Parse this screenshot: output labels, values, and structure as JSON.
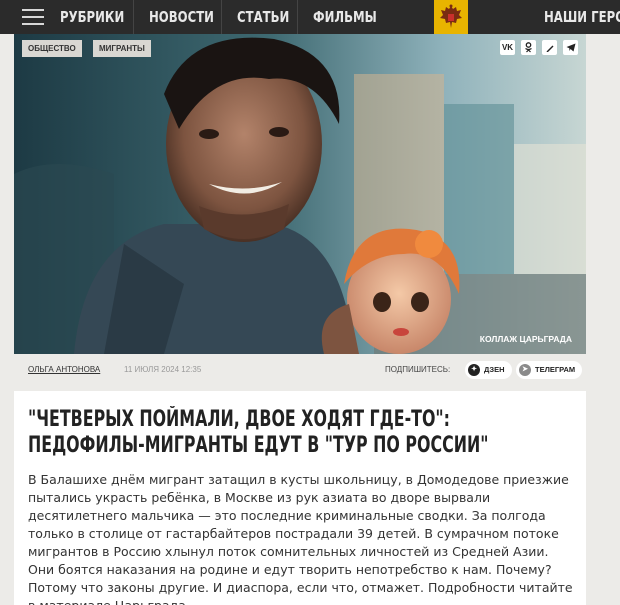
{
  "nav": {
    "items": [
      "РУБРИКИ",
      "НОВОСТИ",
      "СТАТЬИ",
      "ФИЛЬМЫ",
      "НАШИ ГЕРОИ"
    ]
  },
  "hero": {
    "tags": [
      "ОБЩЕСТВО",
      "МИГРАНТЫ"
    ],
    "share_icons": [
      "vk-icon",
      "odnoklassniki-icon",
      "livejournal-icon",
      "telegram-icon"
    ],
    "credit": "КОЛЛАЖ ЦАРЬГРАДА"
  },
  "meta": {
    "author": "ОЛЬГА АНТОНОВА",
    "date": "11 ИЮЛЯ 2024 12:35",
    "subscribe_label": "ПОДПИШИТЕСЬ:",
    "dzen": "ДЗЕН",
    "telegram": "ТЕЛЕГРАМ"
  },
  "article": {
    "title": "\"ЧЕТВЕРЫХ ПОЙМАЛИ, ДВОЕ ХОДЯТ ГДЕ-ТО\": ПЕДОФИЛЫ-МИГРАНТЫ ЕДУТ В \"ТУР ПО РОССИИ\"",
    "lead": "В Балашихе днём мигрант затащил в кусты школьницу, в Домодедове приезжие пытались украсть ребёнка, в Москве из рук азиата во дворе вырвали десятилетнего мальчика — это последние криминальные сводки. За полгода только в столице от гастарбайтеров пострадали 39 детей. В сумрачном потоке мигрантов в Россию хлынул поток сомнительных личностей из Средней Азии. Они боятся наказания на родине и едут творить непотребство к нам. Почему? Потому что законы другие. И диаспора, если что, отмажет. Подробности читайте в материале Царьграда."
  },
  "colors": {
    "topbar": "#2b2b2b",
    "emblem_bg": "#e8b400",
    "page_bg": "#ecebe8"
  }
}
